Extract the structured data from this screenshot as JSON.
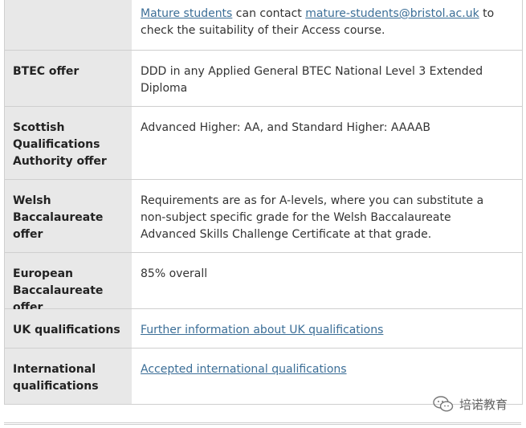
{
  "rows": [
    {
      "label": "",
      "segments": [
        {
          "text": "Mature students",
          "link": true
        },
        {
          "text": " can contact ",
          "link": false
        },
        {
          "text": "mature-students@bristol.ac.uk",
          "link": true
        },
        {
          "text": " to check the suitability of their Access course.",
          "link": false
        }
      ]
    },
    {
      "label": "BTEC offer",
      "segments": [
        {
          "text": "DDD in any Applied General BTEC National Level 3 Extended Diploma",
          "link": false
        }
      ]
    },
    {
      "label": "Scottish Qualifications Authority offer",
      "segments": [
        {
          "text": "Advanced Higher: AA, and Standard Higher: AAAAB",
          "link": false
        }
      ]
    },
    {
      "label": "Welsh Baccalaureate offer",
      "segments": [
        {
          "text": "Requirements are as for A-levels, where you can substitute a non-subject specific grade for the Welsh Baccalaureate Advanced Skills Challenge Certificate at that grade.",
          "link": false
        }
      ]
    },
    {
      "label": "European Baccalaureate offer",
      "segments": [
        {
          "text": "85% overall",
          "link": false
        }
      ]
    },
    {
      "label": "UK qualifications",
      "segments": [
        {
          "text": "Further information about UK qualifications",
          "link": true
        }
      ]
    },
    {
      "label": "International qualifications",
      "segments": [
        {
          "text": "Accepted international qualifications",
          "link": true
        }
      ]
    }
  ],
  "watermark": {
    "text": "培诺教育",
    "icon": "wechat-icon"
  },
  "colors": {
    "header_bg": "#e8e8e8",
    "link": "#3b6e97",
    "border": "#cfcfcf"
  }
}
